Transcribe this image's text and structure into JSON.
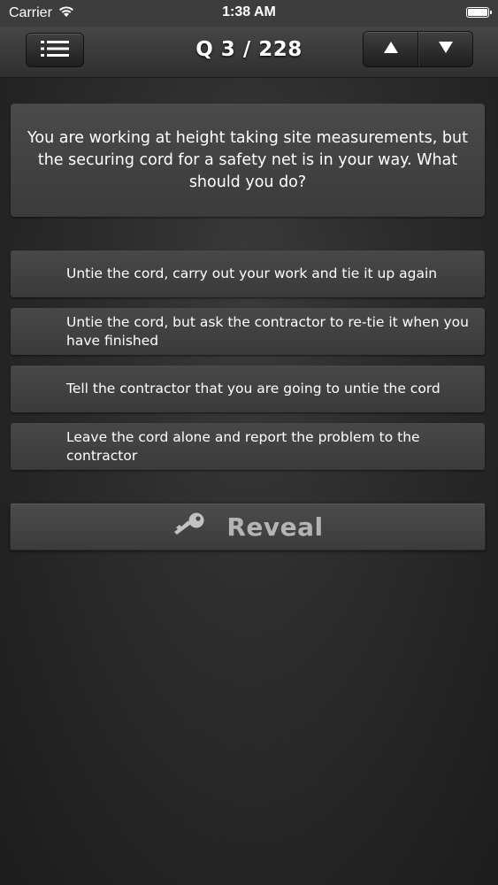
{
  "status_bar": {
    "carrier": "Carrier",
    "time": "1:38 AM",
    "wifi_icon": "wifi-icon",
    "battery_icon": "battery-icon"
  },
  "nav": {
    "menu_icon": "list-menu-icon",
    "title": "Q 3 / 228",
    "up_icon": "triangle-up-icon",
    "down_icon": "triangle-down-icon"
  },
  "question": {
    "text": "You are working at height taking site measurements, but the securing cord for a safety net is in your way. What should you do?"
  },
  "answers": [
    {
      "text": "Untie the cord, carry out your work and tie it up again"
    },
    {
      "text": "Untie the cord, but ask the contractor to re-tie it when you have finished"
    },
    {
      "text": "Tell the contractor that you are going to untie the cord"
    },
    {
      "text": "Leave the cord alone and report the problem to the contractor"
    }
  ],
  "reveal": {
    "label": "Reveal",
    "icon": "key-icon"
  },
  "colors": {
    "background": "#2b2b2b",
    "panel": "#444444",
    "reveal_text": "#b4b4b4"
  }
}
